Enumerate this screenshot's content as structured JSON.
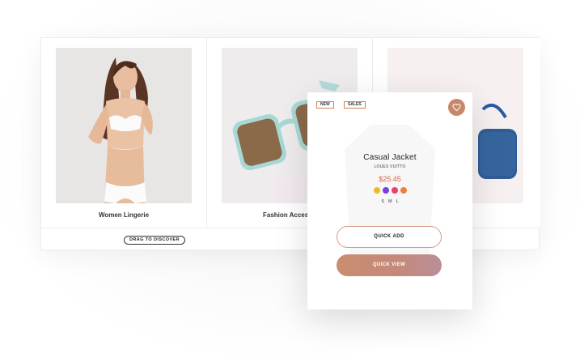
{
  "products": [
    {
      "name": "Women Lingerie"
    },
    {
      "name": "Fashion Accessories"
    },
    {
      "name": ""
    }
  ],
  "drag_label": "DRAG TO DISCOVER",
  "quick_view": {
    "tags": [
      "NEW",
      "SALES"
    ],
    "title": "Casual Jacket",
    "brand": "LOUES VUITTO",
    "price": "$25.45",
    "colors": [
      "#f2b62b",
      "#7b3fe4",
      "#e8416f",
      "#f07c3e"
    ],
    "sizes": [
      "S",
      "M",
      "L"
    ],
    "quick_add_label": "QUICK ADD",
    "quick_view_label": "QUICK VIEW",
    "favorite_icon": "heart-icon",
    "accent": "#c8876a"
  }
}
